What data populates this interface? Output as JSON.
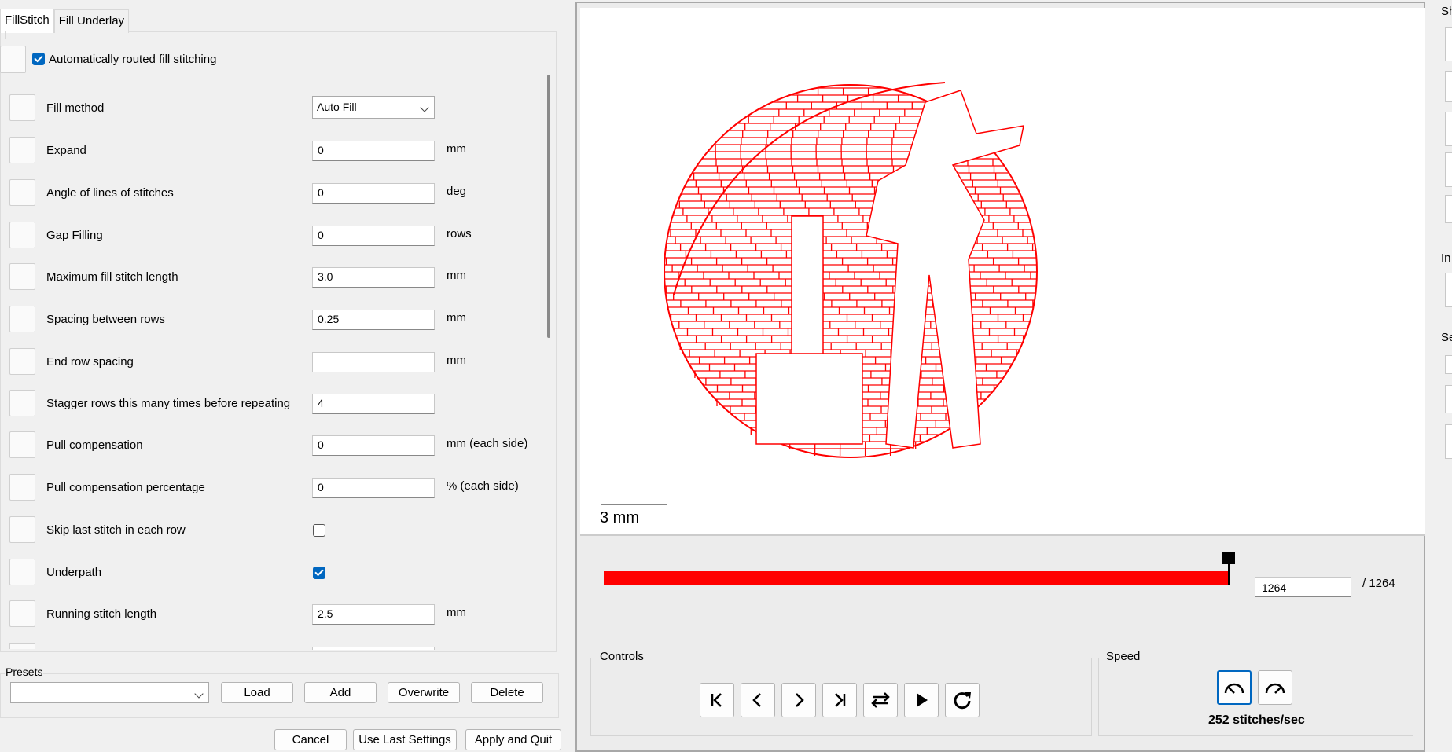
{
  "tabs": [
    "FillStitch",
    "Fill Underlay"
  ],
  "auto_route": {
    "label": "Automatically routed fill stitching",
    "checked": true
  },
  "params": [
    {
      "label": "Fill method",
      "type": "select",
      "value": "Auto Fill",
      "unit": ""
    },
    {
      "label": "Expand",
      "type": "text",
      "value": "0",
      "unit": "mm"
    },
    {
      "label": "Angle of lines of stitches",
      "type": "text",
      "value": "0",
      "unit": "deg"
    },
    {
      "label": "Gap Filling",
      "type": "text",
      "value": "0",
      "unit": "rows"
    },
    {
      "label": "Maximum fill stitch length",
      "type": "text",
      "value": "3.0",
      "unit": "mm"
    },
    {
      "label": "Spacing between rows",
      "type": "text",
      "value": "0.25",
      "unit": "mm"
    },
    {
      "label": "End row spacing",
      "type": "text",
      "value": "",
      "unit": "mm"
    },
    {
      "label": "Stagger rows this many times before repeating",
      "type": "text",
      "value": "4",
      "unit": ""
    },
    {
      "label": "Pull compensation",
      "type": "text",
      "value": "0",
      "unit": "mm (each side)"
    },
    {
      "label": "Pull compensation percentage",
      "type": "text",
      "value": "0",
      "unit": "% (each side)"
    },
    {
      "label": "Skip last stitch in each row",
      "type": "checkbox",
      "checked": false
    },
    {
      "label": "Underpath",
      "type": "checkbox",
      "checked": true
    },
    {
      "label": "Running stitch length",
      "type": "text",
      "value": "2.5",
      "unit": "mm"
    }
  ],
  "presets": {
    "title": "Presets",
    "selected": "",
    "load": "Load",
    "add": "Add",
    "overwrite": "Overwrite",
    "delete": "Delete"
  },
  "footer": {
    "cancel": "Cancel",
    "use_last": "Use Last Settings",
    "apply": "Apply and Quit"
  },
  "preview": {
    "scale_label": "3 mm",
    "stitch_current": "1264",
    "stitch_total": "/ 1264",
    "stitch_progress": 1.0,
    "stitch_color": "#ff0000"
  },
  "controls": {
    "title": "Controls",
    "buttons": [
      "jump-start",
      "step-back",
      "step-forward",
      "jump-end",
      "reverse",
      "play",
      "restart"
    ]
  },
  "speed": {
    "title": "Speed",
    "label": "252 stitches/sec"
  },
  "edge": {
    "labels": [
      "Sh",
      "In",
      "Se"
    ]
  }
}
